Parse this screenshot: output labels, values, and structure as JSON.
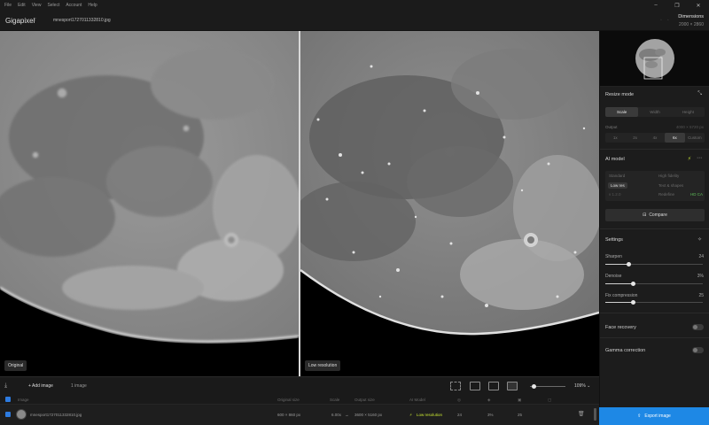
{
  "menu": [
    "File",
    "Edit",
    "View",
    "Select",
    "Account",
    "Help"
  ],
  "header": {
    "app_name": "Gigapixel",
    "app_version": "7",
    "file_name": "mnesport1727011332810.jpg",
    "dimensions_label": "Dimensions",
    "dimensions_value": "2000 × 2860"
  },
  "panes": {
    "left_label": "Original",
    "right_label": "Low resolution"
  },
  "right_panel": {
    "resize_mode": {
      "title": "Resize mode",
      "modes": [
        "Scale",
        "Width",
        "Height"
      ],
      "active_mode": "Scale",
      "output_label": "Output",
      "output_value": "4000 × 5720 px",
      "scales": [
        "1x",
        "2x",
        "4x",
        "6x",
        "Custom"
      ],
      "active_scale": "6x"
    },
    "ai_model": {
      "title": "AI model",
      "options": [
        "Standard",
        "High fidelity",
        "Low res",
        "Text & shapes",
        "CGI",
        "Redefine"
      ],
      "active": "Low res",
      "version": "v 1.2.0",
      "tag": "HD CA",
      "compare_label": "Compare"
    },
    "settings": {
      "title": "Settings",
      "sliders": [
        {
          "label": "Sharpen",
          "value": "24",
          "fraction": 0.24
        },
        {
          "label": "Denoise",
          "value": "3%",
          "fraction": 0.28
        },
        {
          "label": "Fix compression",
          "value": "25",
          "fraction": 0.28
        }
      ]
    },
    "toggles": [
      {
        "label": "Face recovery",
        "on": false
      },
      {
        "label": "Gamma correction",
        "on": false
      }
    ],
    "export_label": "Export image"
  },
  "toolbar": {
    "add_label": "Add image",
    "image_count": "1 image",
    "zoom": "109%"
  },
  "table": {
    "headers": [
      "Image",
      "Original size",
      "Scale",
      "Output size",
      "AI Model"
    ],
    "row": {
      "name": "mnesport1727011332810.jpg",
      "original_size": "600 × 860 px",
      "scale": "6.00x",
      "arrow": "→",
      "output_size": "3600 × 5160 px",
      "model": "Low resolution",
      "sharpen": "24",
      "denoise": "3%",
      "compression": "25"
    }
  },
  "colors": {
    "accent": "#1e88e5",
    "ai_active": "#c8e632",
    "tag_green": "#5fbf5a"
  }
}
